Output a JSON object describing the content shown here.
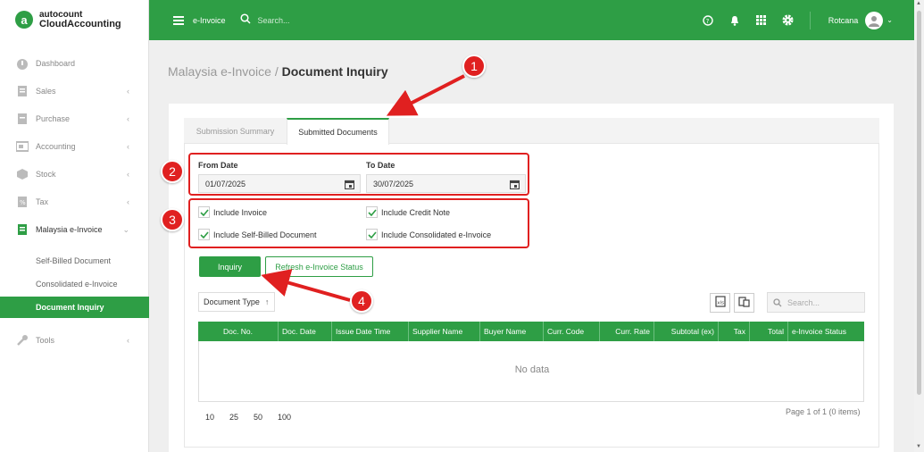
{
  "app": {
    "logo_top": "autocount",
    "logo_bottom": "CloudAccounting"
  },
  "sidebar": {
    "items": [
      {
        "label": "Dashboard",
        "icon": "dashboard-icon"
      },
      {
        "label": "Sales",
        "icon": "sales-icon"
      },
      {
        "label": "Purchase",
        "icon": "purchase-icon"
      },
      {
        "label": "Accounting",
        "icon": "accounting-icon"
      },
      {
        "label": "Stock",
        "icon": "stock-icon"
      },
      {
        "label": "Tax",
        "icon": "tax-icon"
      },
      {
        "label": "Malaysia e-Invoice",
        "icon": "einvoice-icon"
      },
      {
        "label": "Tools",
        "icon": "wrench-icon"
      }
    ],
    "subitems": [
      {
        "label": "Self-Billed Document"
      },
      {
        "label": "Consolidated e-Invoice"
      },
      {
        "label": "Document Inquiry"
      }
    ]
  },
  "topbar": {
    "module": "e-Invoice",
    "search_placeholder": "Search...",
    "user": "Rotcana"
  },
  "breadcrumb": {
    "parent": "Malaysia e-Invoice",
    "separator": " / ",
    "current": "Document Inquiry"
  },
  "tabs": [
    {
      "label": "Submission Summary"
    },
    {
      "label": "Submitted Documents"
    }
  ],
  "form": {
    "from_label": "From Date",
    "from_value": "01/07/2025",
    "to_label": "To Date",
    "to_value": "30/07/2025",
    "checks": [
      {
        "label": "Include Invoice"
      },
      {
        "label": "Include Credit Note"
      },
      {
        "label": "Include Self-Billed Document"
      },
      {
        "label": "Include Consolidated e-Invoice"
      }
    ],
    "inquiry_label": "Inquiry",
    "refresh_label": "Refresh e-Invoice Status"
  },
  "grid": {
    "group_label": "Document Type",
    "sort_glyph": "↑",
    "search_placeholder": "Search...",
    "columns": [
      "Doc. No.",
      "Doc. Date",
      "Issue Date Time",
      "Supplier Name",
      "Buyer Name",
      "Curr. Code",
      "Curr. Rate",
      "Subtotal (ex)",
      "Tax",
      "Total",
      "e-Invoice Status"
    ],
    "no_data": "No data",
    "page_sizes": [
      "10",
      "25",
      "50",
      "100"
    ],
    "page_info": "Page 1 of 1 (0 items)"
  },
  "annotations": {
    "badges": [
      "1",
      "2",
      "3",
      "4"
    ],
    "color": "#e02020"
  },
  "colors": {
    "brand": "#2e9e45"
  }
}
